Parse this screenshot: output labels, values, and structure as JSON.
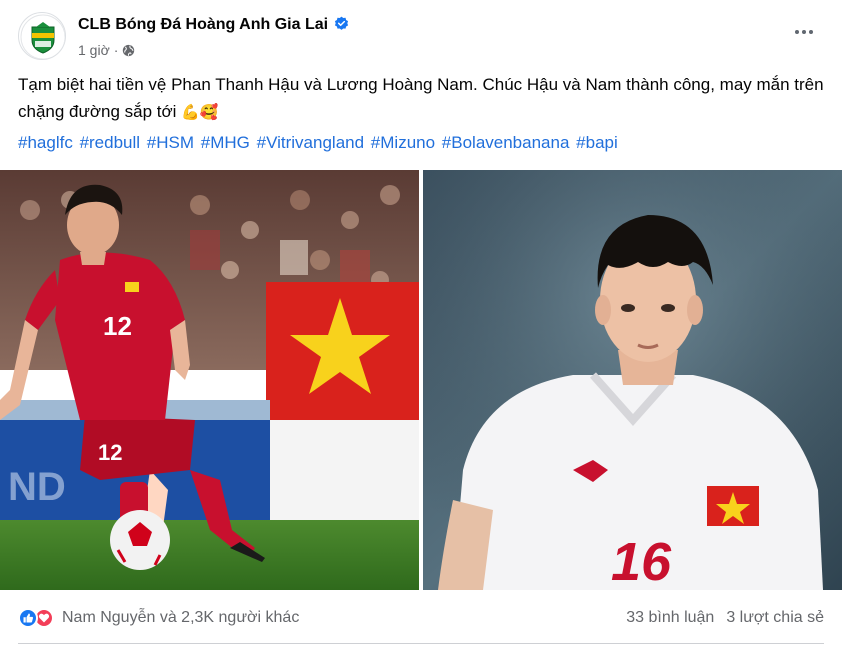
{
  "post": {
    "page_name": "CLB Bóng Đá Hoàng Anh Gia Lai",
    "time": "1 giờ",
    "dot": "·",
    "text": "Tạm biệt hai tiền vệ Phan Thanh Hậu và Lương Hoàng Nam. Chúc Hậu và Nam thành công, may mắn trên chặng đường sắp tới",
    "emojis": "💪🥰",
    "hashtags": [
      "#haglfc",
      "#redbull",
      "#HSM",
      "#MHG",
      "#Vitrivangland",
      "#Mizuno",
      "#Bolavenbanana",
      "#bapi"
    ],
    "photos": [
      {
        "shirt_number": "12",
        "shirt_color": "#c8102e"
      },
      {
        "shirt_number": "16",
        "shirt_color": "#f4f4f6"
      }
    ]
  },
  "footer": {
    "reactions_text": "Nam Nguyễn và 2,3K người khác",
    "comments": "33 bình luận",
    "shares": "3 lượt chia sẻ"
  },
  "colors": {
    "link": "#216fdb",
    "like": "#1877f2",
    "love": "#f33e58",
    "secondary_text": "#65676b"
  }
}
